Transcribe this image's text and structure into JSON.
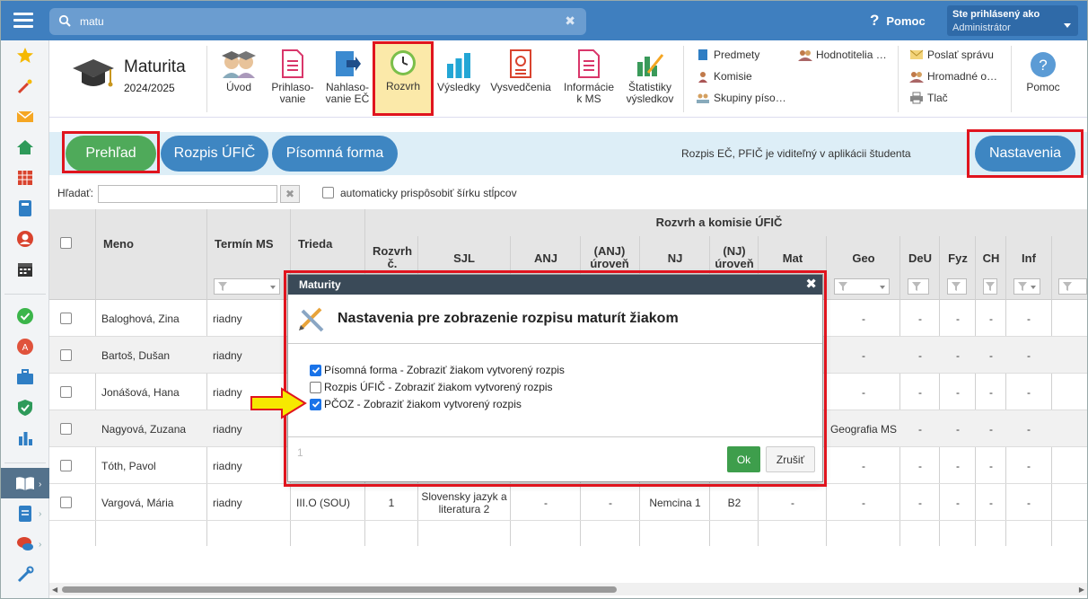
{
  "topbar": {
    "search_value": "matu",
    "help_label": "Pomoc",
    "user_line1": "Ste prihlásený ako",
    "user_line2": "Administrátor"
  },
  "module": {
    "title": "Maturita",
    "year": "2024/2025"
  },
  "ribbon": {
    "buttons": [
      {
        "label1": "Úvod",
        "label2": ""
      },
      {
        "label1": "Prihlaso-",
        "label2": "vanie"
      },
      {
        "label1": "Nahlaso-",
        "label2": "vanie EČ"
      },
      {
        "label1": "Rozvrh",
        "label2": ""
      },
      {
        "label1": "Výsledky",
        "label2": ""
      },
      {
        "label1": "Vysvedčenia",
        "label2": ""
      },
      {
        "label1": "Informácie",
        "label2": "k MS"
      },
      {
        "label1": "Štatistiky",
        "label2": "výsledkov"
      }
    ],
    "small_col1": [
      "Predmety",
      "Komisie",
      "Skupiny píso…"
    ],
    "small_col2": [
      "Hodnotitelia …"
    ],
    "small_col3": [
      "Poslať správu",
      "Hromadné o…",
      "Tlač"
    ],
    "help_label": "Pomoc"
  },
  "tabs": {
    "prehlad": "Prehľad",
    "rozpis": "Rozpis ÚFIČ",
    "pisomna": "Písomná forma",
    "info": "Rozpis EČ, PFIČ je viditeľný v aplikácii študenta",
    "nastavenia": "Nastavenia"
  },
  "filter": {
    "label": "Hľadať:",
    "clear": "✖",
    "auto_label": "automaticky prispôsobiť šírku stĺpcov"
  },
  "grid": {
    "group_header": "Rozvrh a komisie ÚFIČ",
    "columns": {
      "meno": "Meno",
      "termin": "Termín MS",
      "trieda": "Trieda",
      "rozvrh": "Rozvrh č.",
      "sjl": "SJL",
      "anj": "ANJ",
      "anj_uroven": "(ANJ) úroveň",
      "nj": "NJ",
      "nj_uroven": "(NJ) úroveň",
      "mat": "Mat",
      "geo": "Geo",
      "deu": "DeU",
      "fyz": "Fyz",
      "ch": "CH",
      "inf": "Inf"
    },
    "rows": [
      {
        "meno": "Baloghová, Zina",
        "termin": "riadny",
        "geo": "-",
        "deu": "-",
        "fyz": "-",
        "ch": "-",
        "inf": "-"
      },
      {
        "meno": "Bartoš, Dušan",
        "termin": "riadny",
        "geo": "-",
        "deu": "-",
        "fyz": "-",
        "ch": "-",
        "inf": "-"
      },
      {
        "meno": "Jonášová, Hana",
        "termin": "riadny",
        "geo": "-",
        "deu": "-",
        "fyz": "-",
        "ch": "-",
        "inf": "-"
      },
      {
        "meno": "Nagyová, Zuzana",
        "termin": "riadny",
        "geo": "Geografia MS",
        "deu": "-",
        "fyz": "-",
        "ch": "-",
        "inf": "-"
      },
      {
        "meno": "Tóth, Pavol",
        "termin": "riadny",
        "geo": "-",
        "deu": "-",
        "fyz": "-",
        "ch": "-",
        "inf": "-"
      },
      {
        "meno": "Vargová, Mária",
        "termin": "riadny",
        "trieda": "III.O (SOU)",
        "rozvrh": "1",
        "sjl": "Slovensky jazyk a literatura 2",
        "anj": "-",
        "anj_uroven": "-",
        "nj": "Nemcina 1",
        "nj_uroven": "B2",
        "mat": "-",
        "geo": "-",
        "deu": "-",
        "fyz": "-",
        "ch": "-",
        "inf": "-"
      }
    ]
  },
  "modal": {
    "header": "Maturity",
    "close": "✖",
    "title": "Nastavenia pre zobrazenie rozpisu maturít žiakom",
    "options": [
      {
        "label": "Písomná forma - Zobraziť žiakom vytvorený rozpis",
        "checked": true
      },
      {
        "label": "Rozpis ÚFIČ - Zobraziť žiakom vytvorený rozpis",
        "checked": false
      },
      {
        "label": "PČOZ - Zobraziť žiakom vytvorený rozpis",
        "checked": true
      }
    ],
    "footer_num": "1",
    "ok": "Ok",
    "cancel": "Zrušiť"
  },
  "colors": {
    "topbar": "#3f7fbf",
    "green": "#4faa5a",
    "blue": "#3e86c2",
    "annotation_red": "#e0141e",
    "arrow_yellow": "#f6e900"
  }
}
